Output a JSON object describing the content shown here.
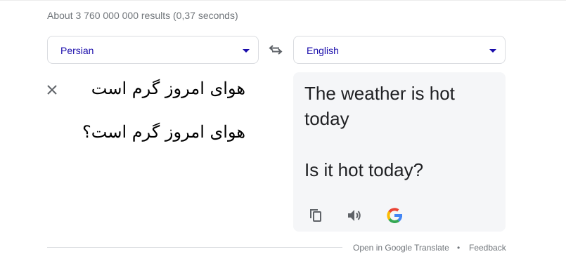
{
  "stats": "About 3 760 000 000 results (0,37 seconds)",
  "source_language": {
    "label": "Persian"
  },
  "target_language": {
    "label": "English"
  },
  "source_text": [
    "هوای امروز گرم است",
    "هوای امروز گرم است؟"
  ],
  "output_text": [
    "The weather is hot today",
    "Is it hot today?"
  ],
  "icons": {
    "dropdown": "chevron-down-icon",
    "swap": "swap-icon",
    "clear": "close-icon",
    "copy": "copy-icon",
    "speak": "speaker-icon",
    "google": "google-logo"
  },
  "footer": {
    "open_link": "Open in Google Translate",
    "separator": "•",
    "feedback": "Feedback"
  },
  "colors": {
    "language_text": "#1a0dab",
    "output_panel": "#f5f6f8",
    "muted": "#70757a"
  }
}
